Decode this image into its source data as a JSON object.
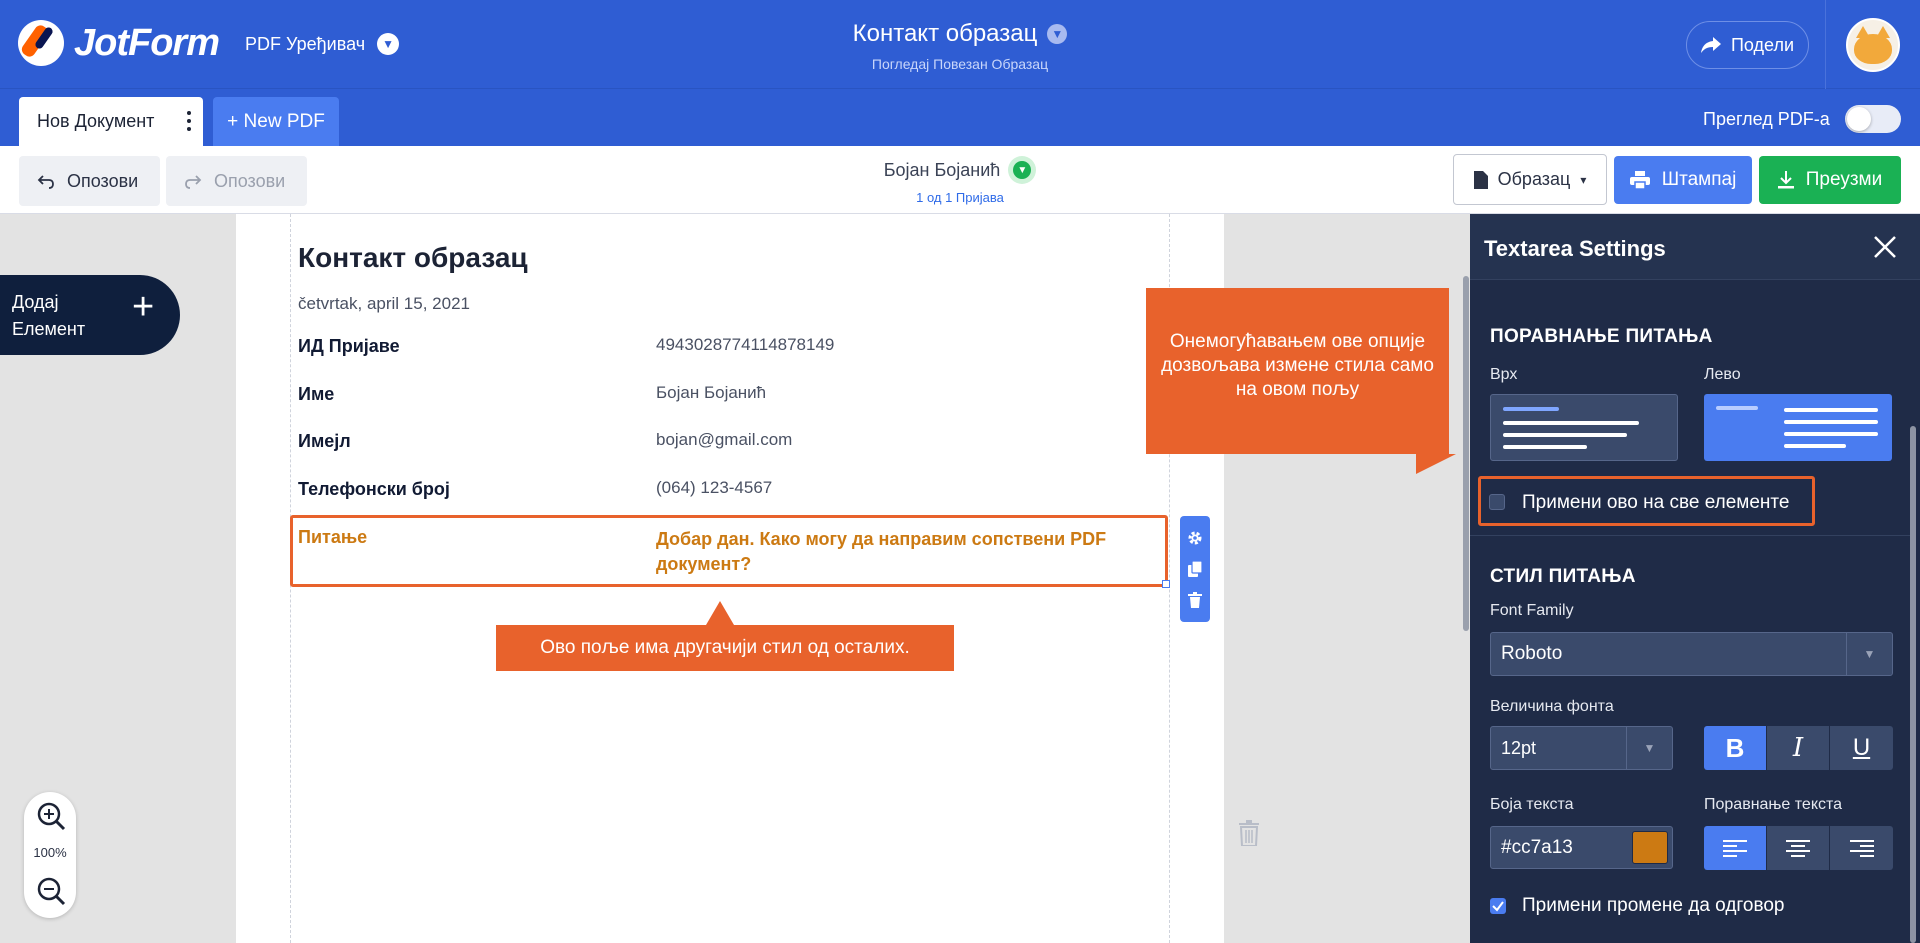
{
  "header": {
    "logo_text": "JotForm",
    "app_name": "PDF Уређивач",
    "doc_title": "Контакт образац",
    "doc_subtitle": "Погледај Повезан Образац",
    "share_label": "Подели"
  },
  "tabs": {
    "document_tab": "Нов Документ",
    "new_pdf": "+ New PDF",
    "preview_label": "Преглед PDF-а"
  },
  "toolbar": {
    "undo": "Опозови",
    "redo": "Опозови",
    "user_name": "Бојан Бојанић",
    "submission_counter": "1 од 1 Пријава",
    "form_button": "Образац",
    "print_button": "Штампај",
    "download_button": "Преузми"
  },
  "canvas": {
    "add_element": [
      "Додај",
      "Елемент"
    ],
    "zoom_level": "100%"
  },
  "document": {
    "title": "Контакт образац",
    "date": "četvrtak, april 15, 2021",
    "rows": [
      {
        "label": "ИД Пријаве",
        "value": "4943028774114878149"
      },
      {
        "label": "Име",
        "value": "Бојан Бојанић"
      },
      {
        "label": "Имејл",
        "value": "bojan@gmail.com"
      },
      {
        "label": "Телефонски број",
        "value": "(064) 123-4567"
      }
    ],
    "highlighted": {
      "label": "Питање",
      "value": "Добар дан. Како могу да направим сопствени PDF документ?"
    }
  },
  "callouts": {
    "bottom": "Ово поље има другачији стил од осталих.",
    "right": "Онемогућавањем ове опције дозвољава измене стила само на овом пољу"
  },
  "panel": {
    "title": "Textarea Settings",
    "question_alignment_title": "ПОРАВНАЊЕ ПИТАЊА",
    "align_top": "Врх",
    "align_left": "Лево",
    "apply_all": "Примени ово на све елементе",
    "apply_all_checked": false,
    "question_style_title": "СТИЛ ПИТАЊА",
    "font_family_label": "Font Family",
    "font_family_value": "Roboto",
    "font_size_label": "Величина фонта",
    "font_size_value": "12pt",
    "bold": "B",
    "italic": "I",
    "underline": "U",
    "text_color_label": "Боја текста",
    "text_color_value": "#cc7a13",
    "text_align_label": "Поравнање текста",
    "apply_answer": "Примени промене да одговор",
    "apply_answer_checked": true
  },
  "colors": {
    "brand_blue": "#2f5dd3",
    "accent_orange": "#e8622c",
    "question_color": "#cc7a13",
    "panel_bg": "#1f2b47",
    "green": "#1ab154"
  }
}
